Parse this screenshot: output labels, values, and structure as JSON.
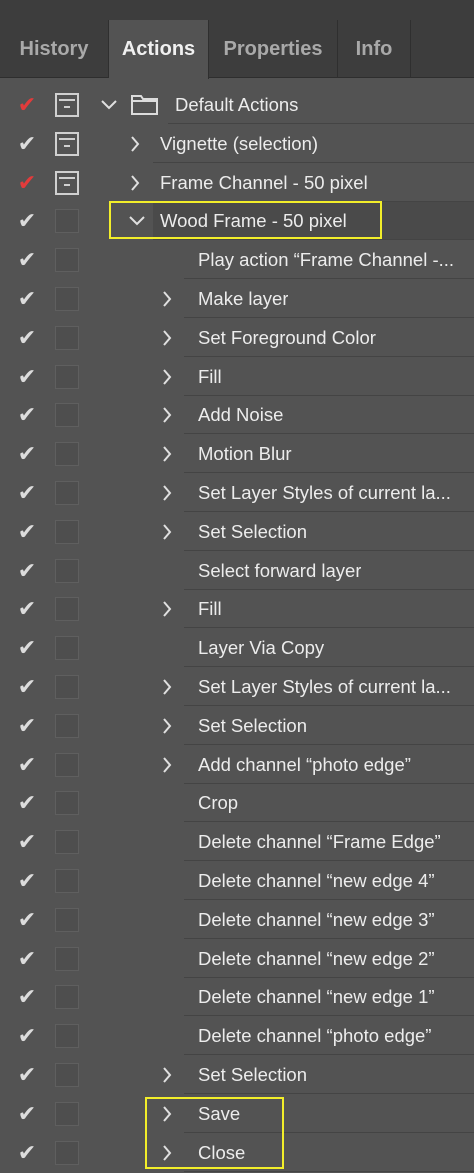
{
  "tabs": [
    {
      "label": "History",
      "active": false
    },
    {
      "label": "Actions",
      "active": true
    },
    {
      "label": "Properties",
      "active": false
    },
    {
      "label": "Info",
      "active": false
    }
  ],
  "rows": [
    {
      "label": "Default Actions",
      "level": 0,
      "arrow": "down",
      "check": "red",
      "dialog": "icon",
      "folder": true
    },
    {
      "label": "Vignette (selection)",
      "level": 1,
      "arrow": "right",
      "check": "white",
      "dialog": "icon"
    },
    {
      "label": "Frame Channel - 50 pixel",
      "level": 1,
      "arrow": "right",
      "check": "red",
      "dialog": "icon"
    },
    {
      "label": "Wood Frame - 50 pixel",
      "level": 1,
      "arrow": "down",
      "check": "white",
      "dialog": "empty",
      "selected": true
    },
    {
      "label": "Play action “Frame Channel -...",
      "level": 2,
      "arrow": "none",
      "check": "white",
      "dialog": "empty"
    },
    {
      "label": "Make layer",
      "level": 2,
      "arrow": "right",
      "check": "white",
      "dialog": "empty"
    },
    {
      "label": "Set Foreground Color",
      "level": 2,
      "arrow": "right",
      "check": "white",
      "dialog": "empty"
    },
    {
      "label": "Fill",
      "level": 2,
      "arrow": "right",
      "check": "white",
      "dialog": "empty"
    },
    {
      "label": "Add Noise",
      "level": 2,
      "arrow": "right",
      "check": "white",
      "dialog": "empty"
    },
    {
      "label": "Motion Blur",
      "level": 2,
      "arrow": "right",
      "check": "white",
      "dialog": "empty"
    },
    {
      "label": "Set Layer Styles of current la...",
      "level": 2,
      "arrow": "right",
      "check": "white",
      "dialog": "empty"
    },
    {
      "label": "Set Selection",
      "level": 2,
      "arrow": "right",
      "check": "white",
      "dialog": "empty"
    },
    {
      "label": "Select forward layer",
      "level": 2,
      "arrow": "none",
      "check": "white",
      "dialog": "empty"
    },
    {
      "label": "Fill",
      "level": 2,
      "arrow": "right",
      "check": "white",
      "dialog": "empty"
    },
    {
      "label": "Layer Via Copy",
      "level": 2,
      "arrow": "none",
      "check": "white",
      "dialog": "empty"
    },
    {
      "label": "Set Layer Styles of current la...",
      "level": 2,
      "arrow": "right",
      "check": "white",
      "dialog": "empty"
    },
    {
      "label": "Set Selection",
      "level": 2,
      "arrow": "right",
      "check": "white",
      "dialog": "empty"
    },
    {
      "label": "Add channel “photo edge”",
      "level": 2,
      "arrow": "right",
      "check": "white",
      "dialog": "empty"
    },
    {
      "label": "Crop",
      "level": 2,
      "arrow": "none",
      "check": "white",
      "dialog": "empty"
    },
    {
      "label": "Delete channel “Frame Edge”",
      "level": 2,
      "arrow": "none",
      "check": "white",
      "dialog": "empty"
    },
    {
      "label": "Delete channel “new edge 4”",
      "level": 2,
      "arrow": "none",
      "check": "white",
      "dialog": "empty"
    },
    {
      "label": "Delete channel “new edge 3”",
      "level": 2,
      "arrow": "none",
      "check": "white",
      "dialog": "empty"
    },
    {
      "label": "Delete channel “new edge 2”",
      "level": 2,
      "arrow": "none",
      "check": "white",
      "dialog": "empty"
    },
    {
      "label": "Delete channel “new edge 1”",
      "level": 2,
      "arrow": "none",
      "check": "white",
      "dialog": "empty"
    },
    {
      "label": "Delete channel “photo edge”",
      "level": 2,
      "arrow": "none",
      "check": "white",
      "dialog": "empty"
    },
    {
      "label": "Set Selection",
      "level": 2,
      "arrow": "right",
      "check": "white",
      "dialog": "empty"
    },
    {
      "label": "Save",
      "level": 2,
      "arrow": "right",
      "check": "white",
      "dialog": "empty",
      "highlight": true
    },
    {
      "label": "Close",
      "level": 2,
      "arrow": "right",
      "check": "white",
      "dialog": "empty",
      "highlight": true
    }
  ],
  "colors": {
    "accent_highlight": "#f2ee2a",
    "check_red": "#e23b3b",
    "panel_bg": "#535353"
  },
  "icons": {
    "check": "checkmark-icon",
    "dialog": "dialog-toggle-icon",
    "folder": "folder-icon",
    "expand": "chevron-right-icon",
    "collapse": "chevron-down-icon"
  }
}
